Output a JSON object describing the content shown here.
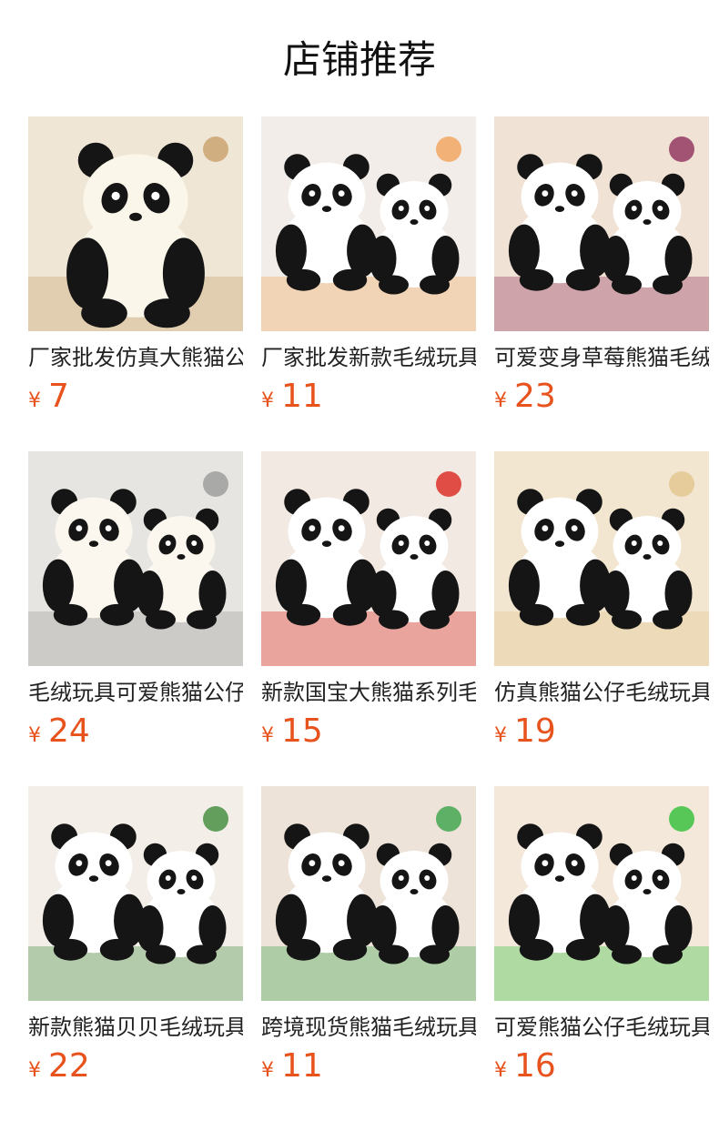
{
  "header": {
    "title": "店铺推荐"
  },
  "currency_symbol": "¥",
  "products": [
    {
      "name": "厂家批发仿真大熊猫公仔",
      "price": "7",
      "image": "panda-on-wooden-crate",
      "colors": {
        "bg": "#efe6d6",
        "accent": "#c9a06a",
        "panda": "#fbf6ea"
      }
    },
    {
      "name": "厂家批发新款毛绒玩具",
      "price": "11",
      "image": "pandas-with-rainbow-flower-hoods",
      "colors": {
        "bg": "#f2ede8",
        "accent": "#f1a35a",
        "panda": "#ffffff"
      }
    },
    {
      "name": "可爱变身草莓熊猫毛绒",
      "price": "23",
      "image": "strawberry-bear-and-panda",
      "colors": {
        "bg": "#f0e2d4",
        "accent": "#8e2f5a",
        "panda": "#ffffff"
      }
    },
    {
      "name": "毛绒玩具可爱熊猫公仔",
      "price": "24",
      "image": "mother-and-baby-pandas-on-sofa",
      "colors": {
        "bg": "#e7e5e2",
        "accent": "#9a9a98",
        "panda": "#fbf7ee"
      }
    },
    {
      "name": "新款国宝大熊猫系列毛绒",
      "price": "15",
      "image": "pandas-with-red-hearts-and-bows",
      "colors": {
        "bg": "#f3e9e3",
        "accent": "#d9261c",
        "panda": "#ffffff"
      }
    },
    {
      "name": "仿真熊猫公仔毛绒玩具",
      "price": "19",
      "image": "pandas-with-flower-crowns",
      "colors": {
        "bg": "#f2e6d0",
        "accent": "#e2c48d",
        "panda": "#ffffff"
      }
    },
    {
      "name": "新款熊猫贝贝毛绒玩具",
      "price": "22",
      "image": "panda-family-with-plants",
      "colors": {
        "bg": "#f3efe8",
        "accent": "#3f8a3a",
        "panda": "#ffffff"
      }
    },
    {
      "name": "跨境现货熊猫毛绒玩具",
      "price": "11",
      "image": "pandas-holding-bamboo",
      "colors": {
        "bg": "#ede3d8",
        "accent": "#3aa24a",
        "panda": "#ffffff"
      }
    },
    {
      "name": "可爱熊猫公仔毛绒玩具",
      "price": "16",
      "image": "pandas-hugging-bamboo",
      "colors": {
        "bg": "#f4e8db",
        "accent": "#2fbf36",
        "panda": "#ffffff"
      }
    }
  ]
}
